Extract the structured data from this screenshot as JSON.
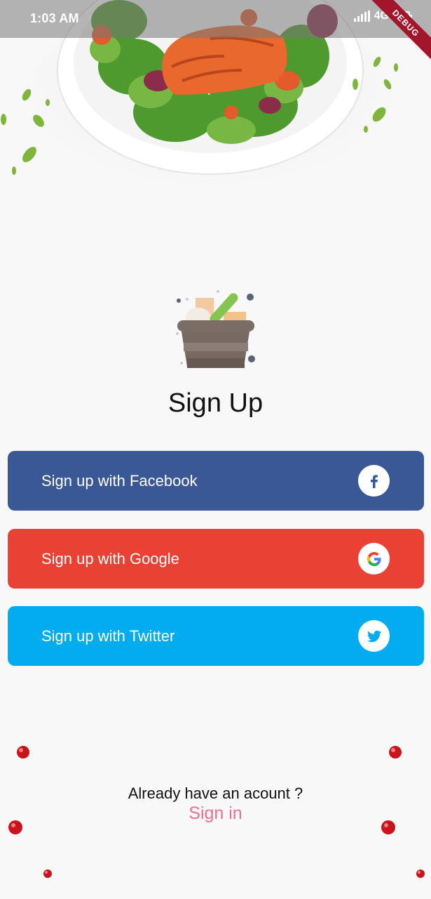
{
  "status_bar": {
    "time": "1:03 AM",
    "network": "4G",
    "icons": [
      "signal-icon",
      "battery-icon"
    ],
    "debug_banner": "DEBUG"
  },
  "header": {
    "image": "salad-plate-image"
  },
  "logo": {
    "icon": "grocery-basket-icon"
  },
  "title": "Sign Up",
  "buttons": {
    "facebook": {
      "label": "Sign up with Facebook",
      "icon": "facebook-icon",
      "color": "#3b5896"
    },
    "google": {
      "label": "Sign up with Google",
      "icon": "google-icon",
      "color": "#e94235"
    },
    "twitter": {
      "label": "Sign up with Twitter",
      "icon": "twitter-icon",
      "color": "#03acee"
    }
  },
  "footer": {
    "prompt": "Already have an acount ?",
    "signin_label": "Sign in",
    "signin_color": "#ee6f8f"
  }
}
